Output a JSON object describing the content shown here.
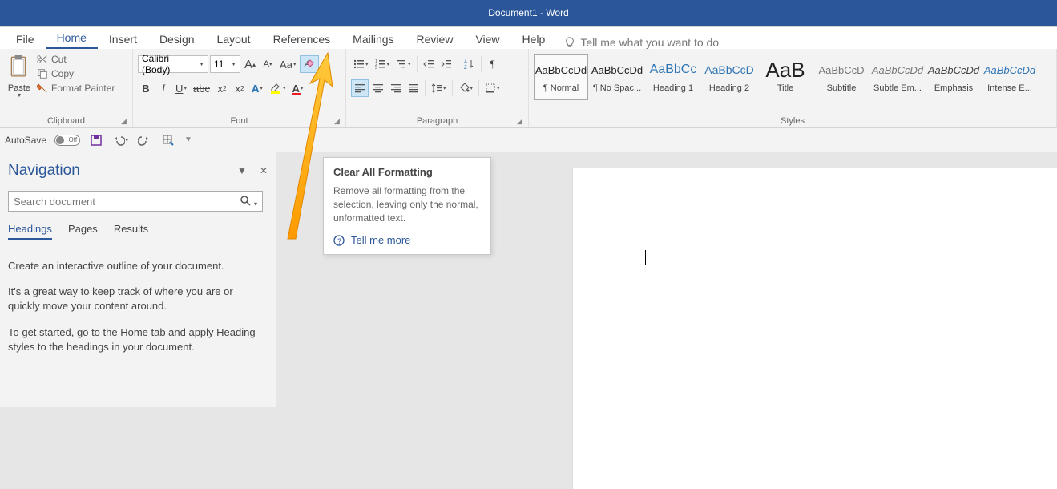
{
  "title": "Document1  -  Word",
  "tabs": [
    "File",
    "Home",
    "Insert",
    "Design",
    "Layout",
    "References",
    "Mailings",
    "Review",
    "View",
    "Help"
  ],
  "active_tab": "Home",
  "tellme": "Tell me what you want to do",
  "clipboard": {
    "paste": "Paste",
    "cut": "Cut",
    "copy": "Copy",
    "painter": "Format Painter",
    "label": "Clipboard"
  },
  "font": {
    "name": "Calibri (Body)",
    "size": "11",
    "label": "Font"
  },
  "paragraph": {
    "label": "Paragraph"
  },
  "styles": {
    "label": "Styles",
    "items": [
      {
        "preview": "AaBbCcDd",
        "name": "¶ Normal",
        "sel": true,
        "color": "#222",
        "sz": "13px"
      },
      {
        "preview": "AaBbCcDd",
        "name": "¶ No Spac...",
        "color": "#222",
        "sz": "13px"
      },
      {
        "preview": "AaBbCc",
        "name": "Heading 1",
        "color": "#2e74b5",
        "sz": "16px"
      },
      {
        "preview": "AaBbCcD",
        "name": "Heading 2",
        "color": "#2e74b5",
        "sz": "14px"
      },
      {
        "preview": "AaB",
        "name": "Title",
        "color": "#222",
        "sz": "26px"
      },
      {
        "preview": "AaBbCcD",
        "name": "Subtitle",
        "color": "#777",
        "sz": "13px"
      },
      {
        "preview": "AaBbCcDd",
        "name": "Subtle Em...",
        "color": "#777",
        "sz": "13px",
        "italic": true
      },
      {
        "preview": "AaBbCcDd",
        "name": "Emphasis",
        "color": "#444",
        "sz": "13px",
        "italic": true
      },
      {
        "preview": "AaBbCcDd",
        "name": "Intense E...",
        "color": "#2e74b5",
        "sz": "13px",
        "italic": true
      }
    ]
  },
  "qat": {
    "autosave": "AutoSave",
    "off": "Off"
  },
  "nav": {
    "title": "Navigation",
    "search_ph": "Search document",
    "tabs": [
      "Headings",
      "Pages",
      "Results"
    ],
    "active": "Headings",
    "p1": "Create an interactive outline of your document.",
    "p2": "It's a great way to keep track of where you are or quickly move your content around.",
    "p3": "To get started, go to the Home tab and apply Heading styles to the headings in your document."
  },
  "tooltip": {
    "title": "Clear All Formatting",
    "desc": "Remove all formatting from the selection, leaving only the normal, unformatted text.",
    "more": "Tell me more"
  }
}
